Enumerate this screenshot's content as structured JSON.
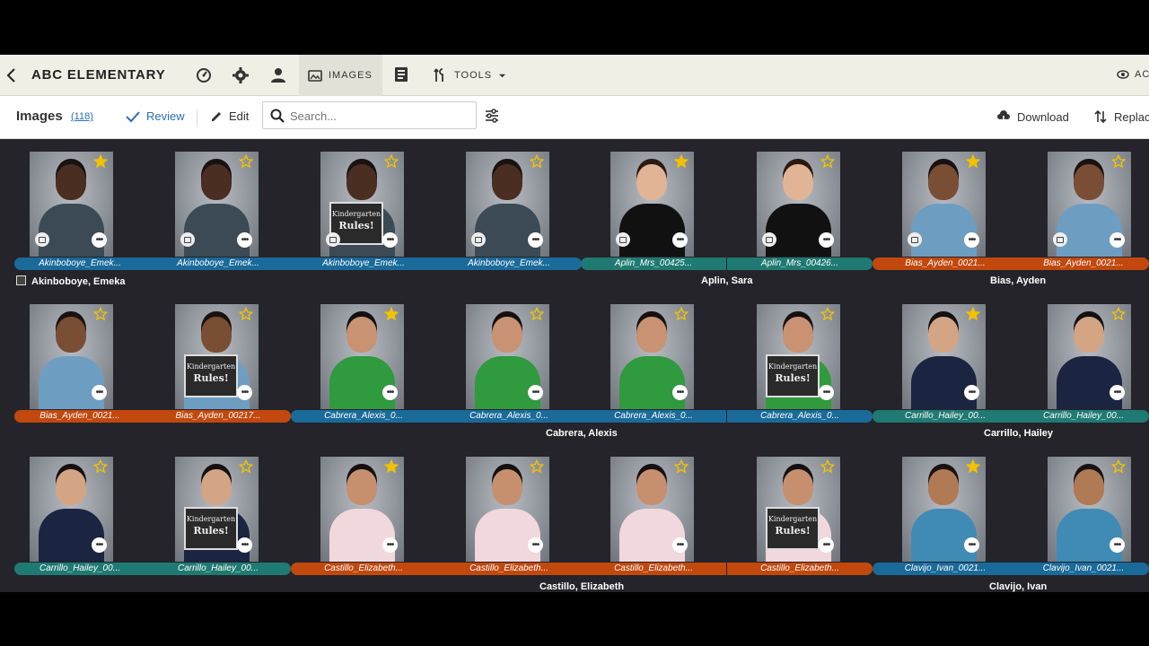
{
  "header": {
    "org_name": "ABC ELEMENTARY",
    "tabs": {
      "images": "IMAGES",
      "tools": "TOOLS"
    },
    "account": "AC"
  },
  "toolbar": {
    "title": "Images",
    "count": "(118)",
    "review": "Review",
    "edit": "Edit",
    "search_placeholder": "Search...",
    "download": "Download",
    "replace": "Replac"
  },
  "rows": [
    {
      "cards": [
        {
          "label": "Akinboboye_Emek...",
          "color": "blue",
          "starred": true,
          "sign": false,
          "theme": "boy1"
        },
        {
          "label": "Akinboboye_Emek...",
          "color": "blue",
          "starred": false,
          "sign": false,
          "theme": "boy1"
        },
        {
          "label": "Akinboboye_Emek...",
          "color": "blue",
          "starred": false,
          "sign": true,
          "theme": "boy1"
        },
        {
          "label": "Akinboboye_Emek...",
          "color": "blue",
          "starred": false,
          "sign": false,
          "theme": "boy1"
        },
        {
          "label": "Aplin_Mrs_00425...",
          "color": "teal",
          "starred": true,
          "sign": false,
          "theme": "woman"
        },
        {
          "label": "Aplin_Mrs_00426...",
          "color": "teal",
          "starred": false,
          "sign": false,
          "theme": "woman"
        },
        {
          "label": "Bias_Ayden_0021...",
          "color": "orange",
          "starred": true,
          "sign": false,
          "theme": "boy2"
        },
        {
          "label": "Bias_Ayden_0021...",
          "color": "orange",
          "starred": false,
          "sign": false,
          "theme": "boy2"
        }
      ],
      "subjects": [
        {
          "name": "Akinboboye, Emeka",
          "icon": true,
          "col": 0
        },
        {
          "name": "Aplin, Sara",
          "icon": false,
          "col": 4.5
        },
        {
          "name": "Bias, Ayden",
          "icon": false,
          "col": 6.5
        }
      ]
    },
    {
      "cards": [
        {
          "label": "Bias_Ayden_0021...",
          "color": "orange",
          "starred": false,
          "sign": false,
          "theme": "boy2"
        },
        {
          "label": "Bias_Ayden_00217...",
          "color": "orange",
          "starred": false,
          "sign": true,
          "theme": "boy2"
        },
        {
          "label": "Cabrera_Alexis_0...",
          "color": "blue",
          "starred": true,
          "sign": false,
          "theme": "girl1"
        },
        {
          "label": "Cabrera_Alexis_0...",
          "color": "blue",
          "starred": false,
          "sign": false,
          "theme": "girl1"
        },
        {
          "label": "Cabrera_Alexis_0...",
          "color": "blue",
          "starred": false,
          "sign": false,
          "theme": "girl1"
        },
        {
          "label": "Cabrera_Alexis_0...",
          "color": "blue",
          "starred": false,
          "sign": true,
          "theme": "girl1"
        },
        {
          "label": "Carrillo_Hailey_00...",
          "color": "teal",
          "starred": true,
          "sign": false,
          "theme": "girl2"
        },
        {
          "label": "Carrillo_Hailey_00...",
          "color": "teal",
          "starred": false,
          "sign": false,
          "theme": "girl2"
        }
      ],
      "subjects": [
        {
          "name": "Cabrera, Alexis",
          "icon": false,
          "col": 3.5
        },
        {
          "name": "Carrillo, Hailey",
          "icon": false,
          "col": 6.5
        }
      ]
    },
    {
      "cards": [
        {
          "label": "Carrillo_Hailey_00...",
          "color": "teal",
          "starred": false,
          "sign": false,
          "theme": "girl2"
        },
        {
          "label": "Carrillo_Hailey_00...",
          "color": "teal",
          "starred": false,
          "sign": true,
          "theme": "girl2"
        },
        {
          "label": "Castillo_Elizabeth...",
          "color": "orange",
          "starred": true,
          "sign": false,
          "theme": "girl3"
        },
        {
          "label": "Castillo_Elizabeth...",
          "color": "orange",
          "starred": false,
          "sign": false,
          "theme": "girl3"
        },
        {
          "label": "Castillo_Elizabeth...",
          "color": "orange",
          "starred": false,
          "sign": false,
          "theme": "girl3"
        },
        {
          "label": "Castillo_Elizabeth...",
          "color": "orange",
          "starred": false,
          "sign": true,
          "theme": "girl3"
        },
        {
          "label": "Clavijo_Ivan_0021...",
          "color": "blue",
          "starred": true,
          "sign": false,
          "theme": "boy3"
        },
        {
          "label": "Clavijo_Ivan_0021...",
          "color": "blue",
          "starred": false,
          "sign": false,
          "theme": "boy3"
        }
      ],
      "subjects": [
        {
          "name": "Castillo, Elizabeth",
          "icon": false,
          "col": 3.5
        },
        {
          "name": "Clavijo, Ivan",
          "icon": false,
          "col": 6.5
        }
      ]
    }
  ],
  "sign_text": {
    "line1": "Kindergarten",
    "line2": "Rules!"
  },
  "colors": {
    "blue": "#1a6a9a",
    "teal": "#1f7a73",
    "orange": "#c2480e",
    "star": "#f2c200",
    "accent": "#2a6ebb"
  },
  "themes": {
    "boy1": {
      "skin": "#4a2e22",
      "shirt": "#3b4a55",
      "hair": "#1a1210"
    },
    "woman": {
      "skin": "#e2b496",
      "shirt": "#111111",
      "hair": "#2a1a12"
    },
    "boy2": {
      "skin": "#7a4e34",
      "shirt": "#6d9ec2",
      "hair": "#1a1210"
    },
    "girl1": {
      "skin": "#c99272",
      "shirt": "#2f9a3e",
      "hair": "#151010"
    },
    "girl2": {
      "skin": "#d4a585",
      "shirt": "#1b2440",
      "hair": "#151010"
    },
    "girl3": {
      "skin": "#c6906e",
      "shirt": "#f1d8dc",
      "hair": "#151010"
    },
    "boy3": {
      "skin": "#b07a55",
      "shirt": "#3f8bb5",
      "hair": "#1a1210"
    }
  }
}
